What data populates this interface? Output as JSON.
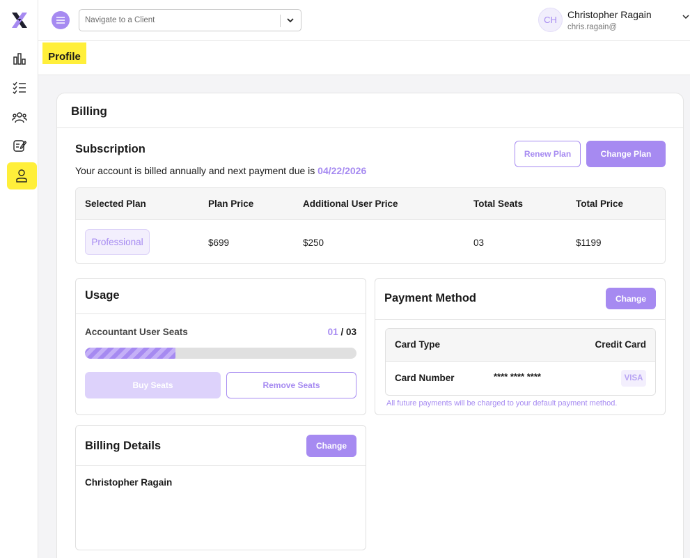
{
  "header": {
    "client_placeholder": "Navigate to a Client",
    "avatar_initials": "CH",
    "user_name": "Christopher Ragain",
    "user_email": "chris.ragain@"
  },
  "sidebar": {
    "items": [
      {
        "icon": "bar-chart-icon"
      },
      {
        "icon": "checklist-icon"
      },
      {
        "icon": "users-icon"
      },
      {
        "icon": "edit-document-icon"
      },
      {
        "icon": "user-icon",
        "active": true
      }
    ]
  },
  "page": {
    "title": "Profile"
  },
  "billing": {
    "title": "Billing",
    "subscription": {
      "title": "Subscription",
      "text": "Your account is billed annually and next payment due is ",
      "due_date": "04/22/2026",
      "renew_label": "Renew Plan",
      "change_label": "Change Plan"
    },
    "plan_table": {
      "headers": [
        "Selected Plan",
        "Plan Price",
        "Additional User Price",
        "Total Seats",
        "Total Price"
      ],
      "row": [
        "Professional",
        "$699",
        "$250",
        "03",
        "$1199"
      ]
    },
    "usage": {
      "title": "Usage",
      "label": "Accountant User Seats",
      "used": "01",
      "separator": " / ",
      "total": "03",
      "fill_fraction": 0.333,
      "buy_label": "Buy Seats",
      "remove_label": "Remove Seats"
    },
    "payment": {
      "title": "Payment Method",
      "change_label": "Change",
      "card_type_label": "Card Type",
      "card_type_value": "Credit Card",
      "card_number_label": "Card Number",
      "card_number_value": "**** **** ****",
      "card_brand": "VISA",
      "note": "All future payments will be charged to your default payment method."
    },
    "billing_details": {
      "title": "Billing Details",
      "change_label": "Change",
      "name": "Christopher Ragain"
    }
  },
  "colors": {
    "accent": "#a68af1",
    "highlight": "#ffef3a"
  }
}
